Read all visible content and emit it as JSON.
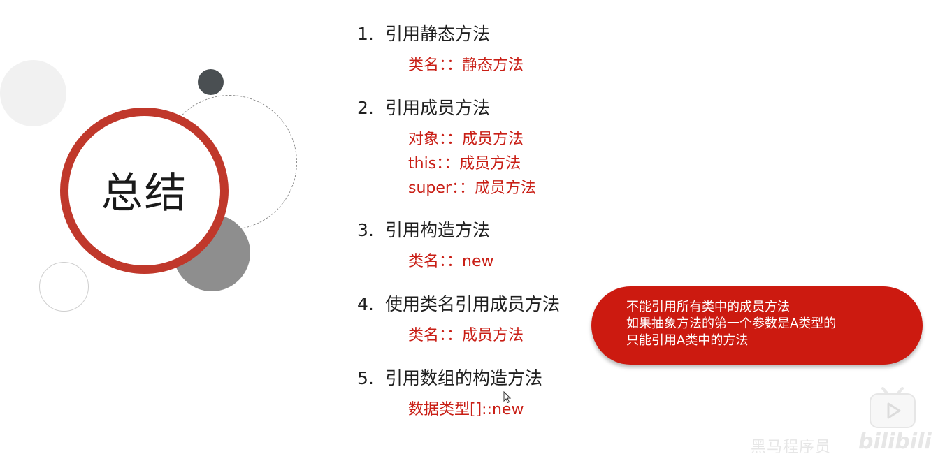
{
  "slide": {
    "title": "总结"
  },
  "items": [
    {
      "num": "1.",
      "heading": "引用静态方法",
      "subs": [
        "类名：：静态方法"
      ]
    },
    {
      "num": "2.",
      "heading": "引用成员方法",
      "subs": [
        "对象：：成员方法",
        "this：：成员方法",
        "super：：成员方法"
      ]
    },
    {
      "num": "3.",
      "heading": "引用构造方法",
      "subs": [
        "类名：：new"
      ]
    },
    {
      "num": "4.",
      "heading": "使用类名引用成员方法",
      "subs": [
        "类名：：成员方法"
      ]
    },
    {
      "num": "5.",
      "heading": "引用数组的构造方法",
      "subs": [
        "数据类型[]::new"
      ]
    }
  ],
  "callout": {
    "lines": [
      "不能引用所有类中的成员方法",
      "如果抽象方法的第一个参数是A类型的",
      "只能引用A类中的方法"
    ]
  },
  "watermark": {
    "text": "黑马程序员",
    "logo": "bilibili"
  },
  "colors": {
    "accent_red": "#c91f16",
    "ring_red": "#c0382b",
    "callout_bg": "#cc1a10"
  },
  "icons": {
    "cursor": "mouse-pointer-icon",
    "bilibili": "bilibili-tv-icon"
  }
}
